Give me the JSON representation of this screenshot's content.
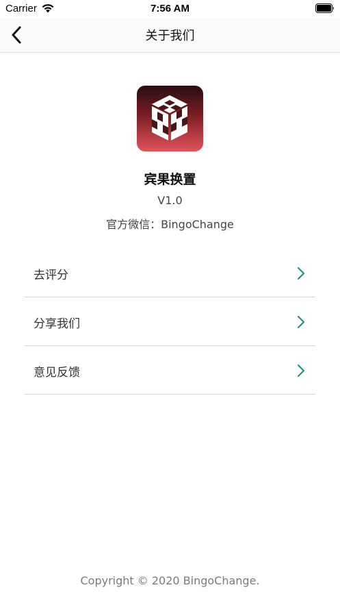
{
  "status_bar": {
    "carrier": "Carrier",
    "time": "7:56 AM",
    "wifi_icon": "wifi-icon",
    "battery_icon": "battery-icon"
  },
  "nav": {
    "title": "关于我们",
    "back_icon": "chevron-left-icon"
  },
  "app": {
    "name": "宾果换置",
    "version": "V1.0",
    "wechat": "官方微信：BingoChange",
    "icon": "cube-logo-icon"
  },
  "menu": {
    "items": [
      {
        "label": "去评分",
        "icon": "chevron-right-icon"
      },
      {
        "label": "分享我们",
        "icon": "chevron-right-icon"
      },
      {
        "label": "意见反馈",
        "icon": "chevron-right-icon"
      }
    ]
  },
  "footer": {
    "copyright": "Copyright © 2020 BingoChange."
  },
  "colors": {
    "accent": "#1a8c7c",
    "icon_gradient_top": "#2a0c0f",
    "icon_gradient_bottom": "#e2545a",
    "divider": "#d4d4d4"
  }
}
